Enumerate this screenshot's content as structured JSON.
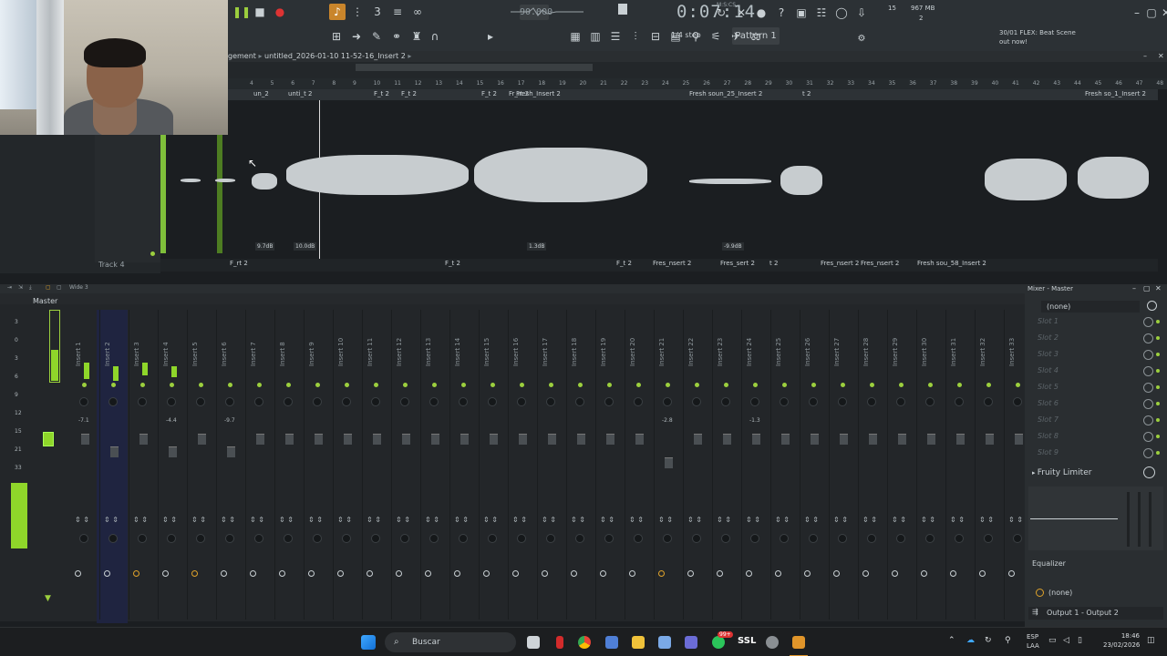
{
  "toolbar": {
    "tempo": "90.000",
    "time": "0:07:14",
    "time_unit": "M:S:CS",
    "step": "1/4 step",
    "pattern": "Pattern 1",
    "cpu": "15",
    "memory": "967 MB",
    "polyphony": "2",
    "news_count": "30/01",
    "news_line1": "FLEX: Beat Scene",
    "news_line2": "out now!"
  },
  "playlist": {
    "breadcrumb_prefix": "gement",
    "breadcrumb_file": "untitled_2026-01-10 11-52-16_Insert 2",
    "ruler_numbers": [
      "4",
      "5",
      "6",
      "7",
      "8",
      "9",
      "10",
      "11",
      "12",
      "13",
      "14",
      "15",
      "16",
      "17",
      "18",
      "19",
      "20",
      "21",
      "22",
      "23",
      "24",
      "25",
      "26",
      "27",
      "28",
      "29",
      "30",
      "31",
      "32",
      "33",
      "34",
      "35",
      "36",
      "37",
      "38",
      "39",
      "40",
      "41",
      "42",
      "43",
      "44",
      "45",
      "46",
      "47",
      "48"
    ],
    "clips_top": [
      "un_2",
      "unti_t 2",
      "F_t 2",
      "F_t 2",
      "F_t 2",
      "Fr_rt 2",
      "Fresh_Insert 2",
      "Fresh soun_25_Insert 2",
      "t 2",
      "Fresh so_1_Insert 2"
    ],
    "clips_bottom": [
      "F_rt 2",
      "F_t 2",
      "F_t 2",
      "Fres_nsert 2",
      "Fres_sert 2",
      "t 2",
      "Fres_nsert 2",
      "Fres_nsert 2",
      "Fresh sou_58_Insert 2"
    ],
    "db_labels": [
      "9.7dB",
      "10.0dB",
      "1.3dB",
      "-9.9dB"
    ],
    "track_label": "Track 4"
  },
  "mixer": {
    "view_label": "Wide 3",
    "master_label": "Master",
    "scale": [
      "3",
      "0",
      "3",
      "6",
      "9",
      "12",
      "15",
      "21",
      "33"
    ],
    "inserts": [
      "Insert 1",
      "Insert 2",
      "Insert 3",
      "Insert 4",
      "Insert 5",
      "Insert 6",
      "Insert 7",
      "Insert 8",
      "Insert 9",
      "Insert 10",
      "Insert 11",
      "Insert 12",
      "Insert 13",
      "Insert 14",
      "Insert 15",
      "Insert 16",
      "Insert 17",
      "Insert 18",
      "Insert 19",
      "Insert 20",
      "Insert 21",
      "Insert 22",
      "Insert 23",
      "Insert 24",
      "Insert 25",
      "Insert 26",
      "Insert 27",
      "Insert 28",
      "Insert 29",
      "Insert 30",
      "Insert 31",
      "Insert 32",
      "Insert 33"
    ],
    "values": [
      "-7.1",
      "-4.4",
      "-9.7",
      "-2.8",
      "-1.3"
    ]
  },
  "master_panel": {
    "title": "Mixer - Master",
    "input": "(none)",
    "slots": [
      "Slot 1",
      "Slot 2",
      "Slot 3",
      "Slot 4",
      "Slot 5",
      "Slot 6",
      "Slot 7",
      "Slot 8",
      "Slot 9"
    ],
    "limiter": "Fruity Limiter",
    "equalizer": "Equalizer",
    "output_none": "(none)",
    "output": "Output 1 - Output 2"
  },
  "taskbar": {
    "search": "Buscar",
    "lang1": "ESP",
    "lang2": "LAA",
    "time": "18:46",
    "date": "23/02/2026",
    "badge": "99+",
    "ssl": "SSL"
  }
}
